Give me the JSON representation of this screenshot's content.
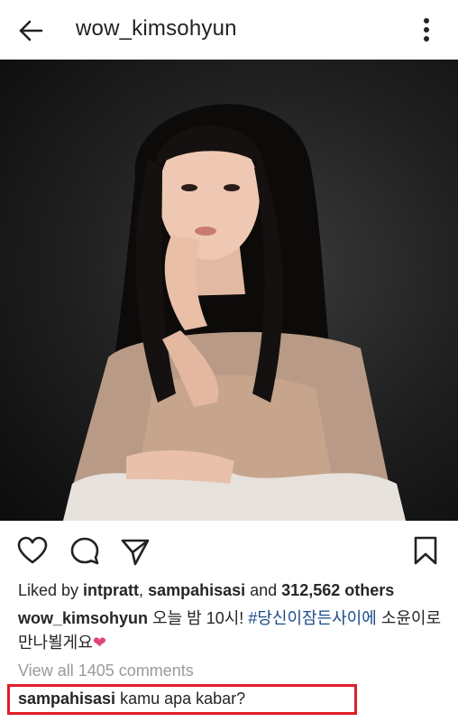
{
  "header": {
    "username": "wow_kimsohyun",
    "back_icon": "arrow-left-icon",
    "more_icon": "more-vertical-icon"
  },
  "post": {
    "image_alt": "portrait photo",
    "actions": {
      "like_icon": "heart-icon",
      "comment_icon": "comment-icon",
      "share_icon": "send-icon",
      "save_icon": "bookmark-icon"
    },
    "likes": {
      "prefix": "Liked by ",
      "user1": "intpratt",
      "sep": ", ",
      "user2": "sampahisasi",
      "and": " and ",
      "count": "312,562 others"
    },
    "caption": {
      "username": "wow_kimsohyun",
      "text1": " 오늘 밤 10시! ",
      "hashtag": "#당신이잠든사이에",
      "text2": " 소윤이로 만나뵐게요",
      "emoji": "❤"
    },
    "view_all_comments": "View all 1405 comments",
    "comment": {
      "username": "sampahisasi",
      "text": " kamu apa kabar?"
    }
  },
  "colors": {
    "highlight_border": "#e11d2a",
    "hashtag": "#1a4c8a",
    "muted": "#9a9a9a"
  }
}
